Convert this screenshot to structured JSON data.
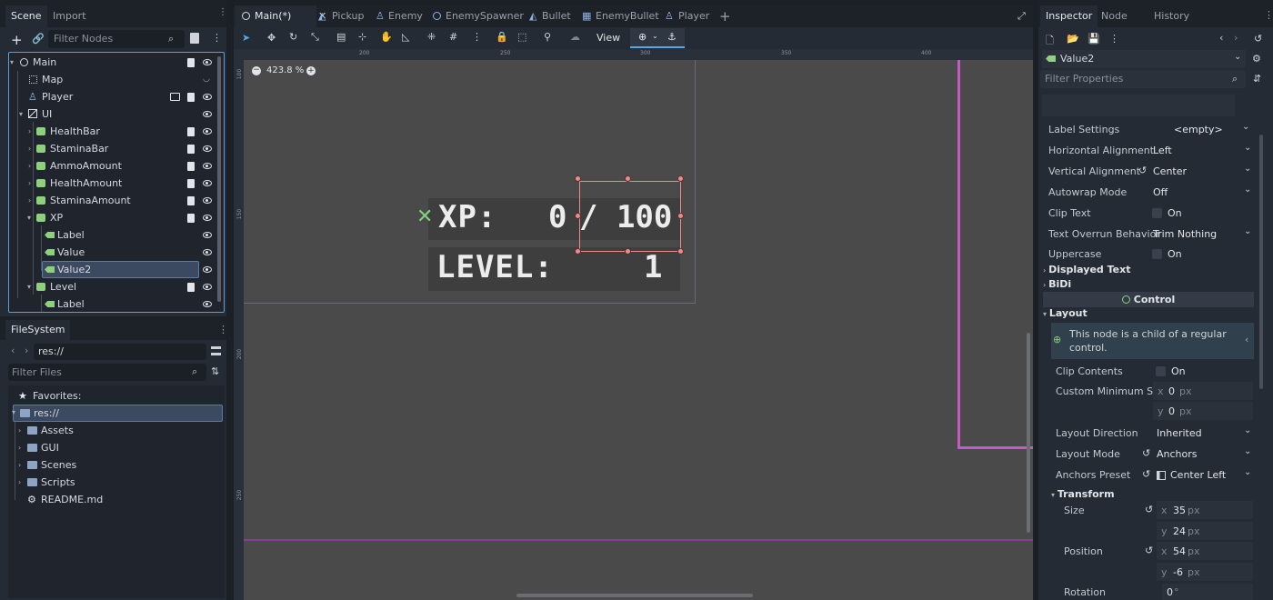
{
  "scene_dock": {
    "tabs": [
      "Scene",
      "Import"
    ],
    "filter_placeholder": "Filter Nodes",
    "tree": [
      {
        "name": "Main",
        "icon": "node-icon"
      },
      {
        "name": "Map",
        "icon": "tilemap-icon"
      },
      {
        "name": "Player",
        "icon": "character-icon"
      },
      {
        "name": "UI",
        "icon": "canvas-layer-icon"
      },
      {
        "name": "HealthBar",
        "icon": "control-icon"
      },
      {
        "name": "StaminaBar",
        "icon": "control-icon"
      },
      {
        "name": "AmmoAmount",
        "icon": "control-icon"
      },
      {
        "name": "HealthAmount",
        "icon": "control-icon"
      },
      {
        "name": "StaminaAmount",
        "icon": "control-icon"
      },
      {
        "name": "XP",
        "icon": "control-icon"
      },
      {
        "name": "Label",
        "icon": "label-icon"
      },
      {
        "name": "Value",
        "icon": "label-icon"
      },
      {
        "name": "Value2",
        "icon": "label-icon"
      },
      {
        "name": "Level",
        "icon": "control-icon"
      },
      {
        "name": "Label",
        "icon": "label-icon"
      }
    ]
  },
  "filesystem": {
    "tab": "FileSystem",
    "path": "res://",
    "filter_placeholder": "Filter Files",
    "favorites": "Favorites:",
    "root": "res://",
    "items": [
      "Assets",
      "GUI",
      "Scenes",
      "Scripts",
      "README.md"
    ]
  },
  "editor_tabs": [
    "Main(*)",
    "Pickup",
    "Enemy",
    "EnemySpawner",
    "Bullet",
    "EnemyBullet",
    "Player"
  ],
  "toolbar": {
    "view_label": "View"
  },
  "viewport": {
    "zoom": "423.8 %",
    "ruler_h": [
      "200",
      "250",
      "300",
      "350",
      "400"
    ],
    "ruler_v": [
      "100",
      "150",
      "200",
      "250"
    ],
    "xp_label": "XP:",
    "xp_value": "0",
    "xp_max": "/ 100",
    "level_label": "LEVEL:",
    "level_value": "1"
  },
  "inspector": {
    "tabs": [
      "Inspector",
      "Node",
      "History"
    ],
    "object": "Value2",
    "filter_placeholder": "Filter Properties",
    "props": [
      {
        "label": "Label Settings",
        "value": "<empty>"
      },
      {
        "label": "Horizontal Alignment",
        "value": "Left"
      },
      {
        "label": "Vertical Alignment",
        "value": "Center"
      },
      {
        "label": "Autowrap Mode",
        "value": "Off"
      },
      {
        "label": "Clip Text",
        "value": "On"
      },
      {
        "label": "Text Overrun Behavior",
        "value": "Trim Nothing"
      },
      {
        "label": "Uppercase",
        "value": "On"
      }
    ],
    "section_displayed_text": "Displayed Text",
    "section_bidi": "BiDi",
    "category_control": "Control",
    "section_layout": "Layout",
    "layout_note": "This node is a child of a regular control.",
    "layout_props": [
      {
        "label": "Clip Contents",
        "value": "On"
      },
      {
        "label": "Custom Minimum S...",
        "x": "0",
        "y": "0",
        "unit": "px"
      },
      {
        "label": "Layout Direction",
        "value": "Inherited"
      },
      {
        "label": "Layout Mode",
        "value": "Anchors"
      },
      {
        "label": "Anchors Preset",
        "value": "Center Left"
      }
    ],
    "section_transform": "Transform",
    "size": {
      "label": "Size",
      "x": "35",
      "y": "24",
      "unit": "px"
    },
    "position": {
      "label": "Position",
      "x": "54",
      "y": "-6",
      "unit": "px"
    },
    "rotation": {
      "label": "Rotation",
      "value": "0",
      "unit": "°"
    },
    "axis_x": "x",
    "axis_y": "y"
  },
  "colors": {
    "accent": "#5aa6e8",
    "selection": "#3b4a60",
    "guide": "#c45ac4",
    "label_green": "#8fd07f"
  }
}
